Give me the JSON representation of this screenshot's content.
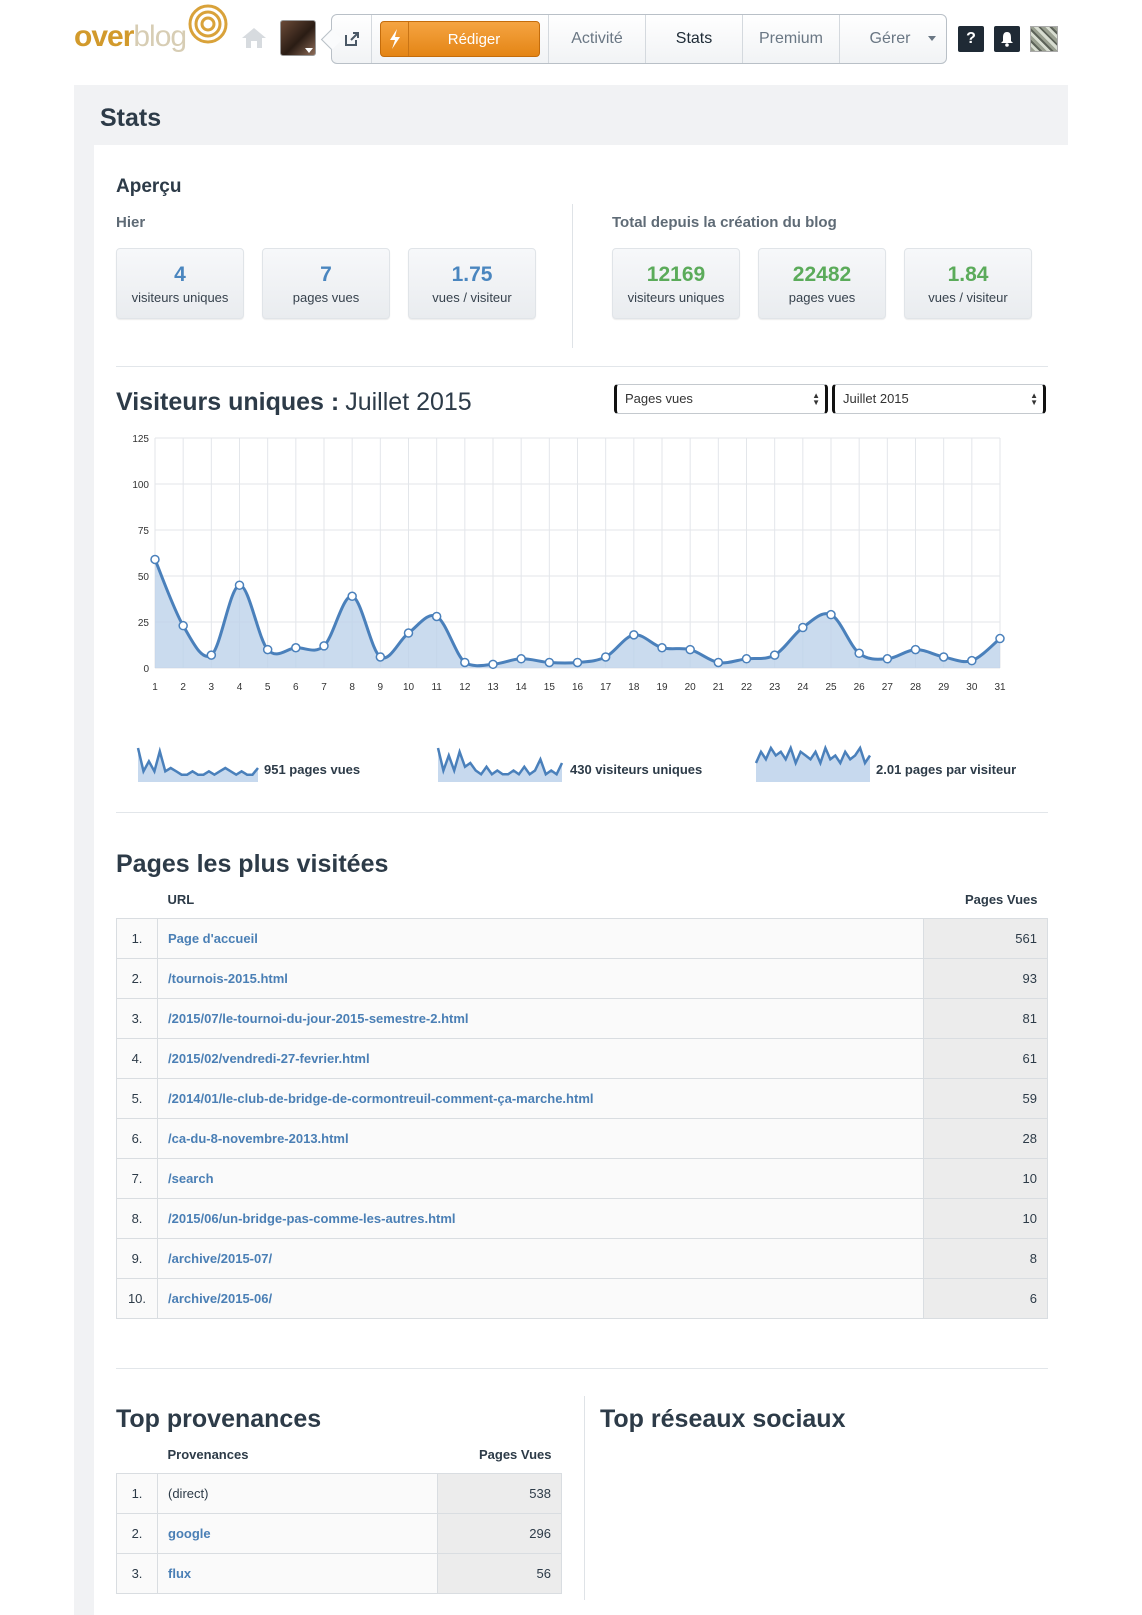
{
  "nav": {
    "logo_over": "over",
    "logo_blog": "blog",
    "write_label": "Rédiger",
    "activite": "Activité",
    "stats": "Stats",
    "premium": "Premium",
    "gerer": "Gérer",
    "help": "?",
    "accent_color": "#e8891a"
  },
  "page": {
    "title": "Stats",
    "overview_title": "Aperçu",
    "yesterday_label": "Hier",
    "total_label": "Total depuis la création du blog",
    "yesterday": [
      {
        "value": "4",
        "label": "visiteurs uniques"
      },
      {
        "value": "7",
        "label": "pages vues"
      },
      {
        "value": "1.75",
        "label": "vues / visiteur"
      }
    ],
    "total": [
      {
        "value": "12169",
        "label": "visiteurs uniques"
      },
      {
        "value": "22482",
        "label": "pages vues"
      },
      {
        "value": "1.84",
        "label": "vues / visiteur"
      }
    ]
  },
  "chart_header": {
    "title": "Visiteurs uniques :",
    "month": "Juillet 2015",
    "metric_select": "Pages vues",
    "month_select": "Juillet 2015"
  },
  "chart_data": {
    "type": "area",
    "x": [
      1,
      2,
      3,
      4,
      5,
      6,
      7,
      8,
      9,
      10,
      11,
      12,
      13,
      14,
      15,
      16,
      17,
      18,
      19,
      20,
      21,
      22,
      23,
      24,
      25,
      26,
      27,
      28,
      29,
      30,
      31
    ],
    "series": [
      {
        "values": [
          59,
          23,
          7,
          45,
          10,
          11,
          12,
          39,
          6,
          19,
          28,
          3,
          2,
          5,
          3,
          3,
          6,
          18,
          11,
          10,
          3,
          5,
          7,
          22,
          29,
          8,
          5,
          10,
          6,
          4,
          16
        ]
      }
    ],
    "ylim": [
      0,
      125
    ],
    "yticks": [
      "0",
      "25",
      "50",
      "75",
      "100",
      "125"
    ],
    "xticks": [
      "1",
      "2",
      "3",
      "4",
      "5",
      "6",
      "7",
      "8",
      "9",
      "10",
      "11",
      "12",
      "13",
      "14",
      "15",
      "16",
      "17",
      "18",
      "19",
      "20",
      "21",
      "22",
      "23",
      "24",
      "25",
      "26",
      "27",
      "28",
      "29",
      "30",
      "31"
    ],
    "grid": true,
    "line_color": "#4a80bb",
    "fill_color": "#bdd2ea"
  },
  "sparklines": [
    {
      "label": "951 pages vues",
      "values": [
        9,
        2,
        5,
        2,
        8,
        2,
        3,
        2,
        1,
        1,
        2,
        1,
        1,
        2,
        1,
        2,
        3,
        2,
        1,
        2,
        1,
        1,
        3
      ]
    },
    {
      "label": "430 visiteurs uniques",
      "values": [
        8,
        2,
        6,
        2,
        7,
        3,
        4,
        2,
        1,
        3,
        1,
        2,
        1,
        1,
        2,
        1,
        3,
        1,
        2,
        5,
        1,
        2,
        1,
        4
      ]
    },
    {
      "label": "2.01 pages par visiteur",
      "values": [
        4,
        7,
        5,
        8,
        6,
        7,
        5,
        8,
        4,
        7,
        6,
        5,
        7,
        4,
        8,
        5,
        6,
        4,
        7,
        5,
        6,
        8,
        4,
        6
      ]
    }
  ],
  "top_pages": {
    "title": "Pages les plus visitées",
    "col_url": "URL",
    "col_views": "Pages Vues",
    "rows": [
      {
        "rank": "1.",
        "url": "Page d'accueil",
        "views": "561"
      },
      {
        "rank": "2.",
        "url": "/tournois-2015.html",
        "views": "93"
      },
      {
        "rank": "3.",
        "url": "/2015/07/le-tournoi-du-jour-2015-semestre-2.html",
        "views": "81"
      },
      {
        "rank": "4.",
        "url": "/2015/02/vendredi-27-fevrier.html",
        "views": "61"
      },
      {
        "rank": "5.",
        "url": "/2014/01/le-club-de-bridge-de-cormontreuil-comment-ça-marche.html",
        "views": "59"
      },
      {
        "rank": "6.",
        "url": "/ca-du-8-novembre-2013.html",
        "views": "28"
      },
      {
        "rank": "7.",
        "url": "/search",
        "views": "10"
      },
      {
        "rank": "8.",
        "url": "/2015/06/un-bridge-pas-comme-les-autres.html",
        "views": "10"
      },
      {
        "rank": "9.",
        "url": "/archive/2015-07/",
        "views": "8"
      },
      {
        "rank": "10.",
        "url": "/archive/2015-06/",
        "views": "6"
      }
    ]
  },
  "top_sources": {
    "title": "Top provenances",
    "col_source": "Provenances",
    "col_views": "Pages Vues",
    "rows": [
      {
        "rank": "1.",
        "source": "(direct)",
        "views": "538"
      },
      {
        "rank": "2.",
        "source": "google",
        "views": "296"
      },
      {
        "rank": "3.",
        "source": "flux",
        "views": "56"
      }
    ]
  },
  "top_social": {
    "title": "Top réseaux sociaux"
  }
}
